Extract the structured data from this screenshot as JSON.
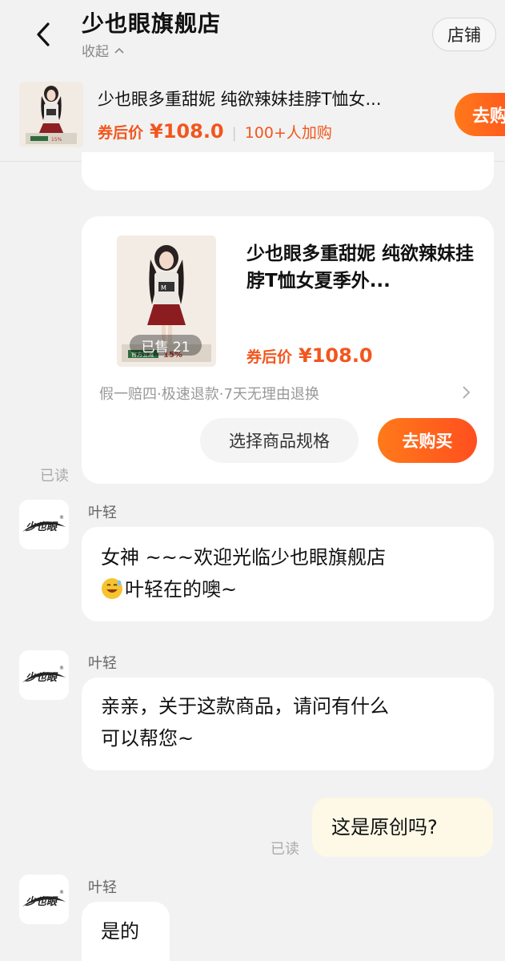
{
  "header": {
    "shop_name": "少也眼旗舰店",
    "collapse_label": "收起",
    "store_button": "店铺"
  },
  "pinned_product": {
    "title": "少也眼多重甜妮 纯欲辣妹挂脖T恤女...",
    "coupon_label": "券后价",
    "price": "¥108.0",
    "buyers": "100+人加购",
    "buy_label": "去购"
  },
  "product_card": {
    "title": "少也眼多重甜妮 纯欲辣妹挂脖T恤女夏季外...",
    "sold": "已售 21",
    "coupon_label": "券后价",
    "price": "¥108.0",
    "guarantee": "假一赔四·极速退款·7天无理由退换",
    "spec_button": "选择商品规格",
    "buy_button": "去购买"
  },
  "read_label": "已读",
  "messages": [
    {
      "sender": "叶轻",
      "line1": "女神 ~~~欢迎光临少也眼旗舰店",
      "line2": "叶轻在的噢~",
      "emoji": "grinning-sweat-emoji"
    },
    {
      "sender": "叶轻",
      "line1": "亲亲，关于这款商品，请问有什么",
      "line2": "可以帮您~"
    },
    {
      "sender": "me",
      "text": "这是原创吗?"
    },
    {
      "sender": "叶轻",
      "text": "是的"
    }
  ],
  "colors": {
    "accent": "#f2561d",
    "button_gradient_start": "#ff7a1a",
    "button_gradient_end": "#ff4f1f",
    "background": "#f2f2f2",
    "my_bubble": "#fdf9e6"
  }
}
